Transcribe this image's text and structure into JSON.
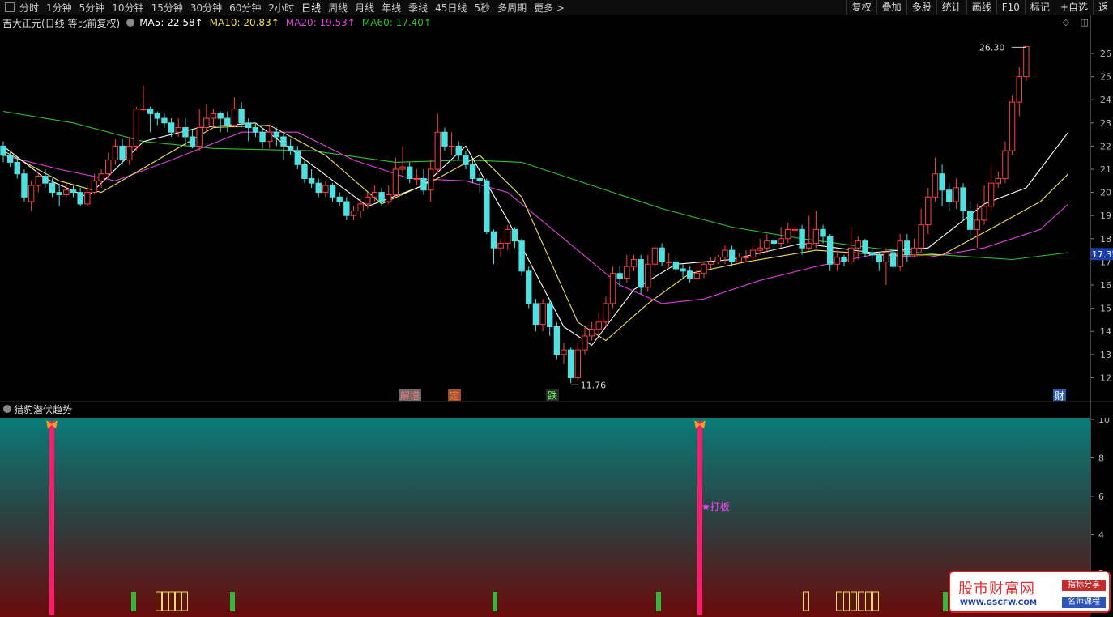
{
  "toolbar": {
    "periods": [
      "分时",
      "1分钟",
      "5分钟",
      "10分钟",
      "15分钟",
      "30分钟",
      "60分钟",
      "2小时",
      "日线",
      "周线",
      "月线",
      "年线",
      "季线",
      "45日线",
      "5秒",
      "多周期",
      "更多 >"
    ],
    "active_period": "日线",
    "right_buttons": [
      "复权",
      "叠加",
      "多股",
      "统计",
      "画线",
      "F10",
      "标记",
      "+自选",
      "返"
    ]
  },
  "info": {
    "stock_title": "吉大正元(日线 等比前复权)",
    "ma5": "MA5: 22.58↑",
    "ma10": "MA10: 20.83↑",
    "ma20": "MA20: 19.53↑",
    "ma60": "MA60: 17.40↑"
  },
  "colors": {
    "ma5": "#ffffff",
    "ma10": "#f0e060",
    "ma20": "#e040e0",
    "ma60": "#30c030",
    "up": "#ff4040",
    "down": "#50e0e0",
    "price_tag_bg": "#1a3eaa"
  },
  "price_labels": {
    "high_marker": "26.30",
    "low_marker": "11.76",
    "current_price_tag": "17.32"
  },
  "y_axis_ticks": [
    "26",
    "25",
    "24",
    "23",
    "22",
    "21",
    "20",
    "19",
    "18",
    "17",
    "16",
    "15",
    "14",
    "13",
    "12"
  ],
  "event_markers": [
    {
      "label": "解增",
      "color": "#ff8080",
      "bg": "#6a6a6a"
    },
    {
      "label": "定",
      "color": "#ff8040",
      "bg": "#a05030"
    },
    {
      "label": "跌",
      "color": "#60ff60",
      "bg": "#2a2a2a"
    },
    {
      "label": "财",
      "color": "#ffffff",
      "bg": "#2a5ab0"
    }
  ],
  "indicator": {
    "title": "猎豹潜伏趋势",
    "signal_label": "★打板",
    "y_ticks": [
      "10",
      "8",
      "6",
      "4",
      "2"
    ]
  },
  "watermark": {
    "name": "股市财富网",
    "url": "WWW.GSCFW.COM",
    "tag1": "指标分享",
    "tag2": "名师课程"
  },
  "chart_data": {
    "type": "candlestick",
    "y_range": [
      11.5,
      26.6
    ],
    "candles": [
      [
        22.0,
        21.6,
        22.2,
        21.3
      ],
      [
        21.6,
        21.3,
        21.8,
        21.1
      ],
      [
        21.3,
        20.8,
        21.5,
        20.6
      ],
      [
        20.8,
        19.8,
        21.0,
        19.6
      ],
      [
        19.6,
        20.3,
        20.5,
        19.2
      ],
      [
        20.3,
        20.7,
        20.9,
        20.0
      ],
      [
        20.7,
        20.4,
        21.0,
        20.2
      ],
      [
        20.4,
        20.0,
        20.6,
        19.8
      ],
      [
        20.0,
        19.9,
        20.3,
        19.4
      ],
      [
        19.9,
        20.1,
        20.4,
        19.8
      ],
      [
        20.1,
        20.0,
        20.3,
        19.8
      ],
      [
        20.0,
        19.5,
        20.2,
        19.4
      ],
      [
        19.5,
        20.0,
        20.3,
        19.4
      ],
      [
        20.0,
        20.5,
        20.8,
        19.9
      ],
      [
        20.5,
        20.8,
        21.0,
        20.2
      ],
      [
        20.8,
        21.4,
        21.7,
        20.6
      ],
      [
        21.4,
        22.0,
        22.3,
        21.2
      ],
      [
        22.0,
        21.4,
        22.3,
        21.2
      ],
      [
        21.4,
        22.0,
        22.4,
        21.2
      ],
      [
        22.0,
        23.6,
        23.7,
        21.8
      ],
      [
        23.6,
        23.6,
        24.6,
        23.5
      ],
      [
        23.6,
        23.4,
        23.7,
        22.6
      ],
      [
        23.4,
        23.2,
        23.5,
        22.9
      ],
      [
        23.2,
        23.0,
        23.4,
        22.8
      ],
      [
        23.0,
        22.6,
        23.2,
        22.4
      ],
      [
        22.6,
        22.8,
        23.2,
        22.4
      ],
      [
        22.8,
        22.4,
        23.2,
        22.0
      ],
      [
        22.4,
        22.0,
        22.7,
        21.9
      ],
      [
        22.0,
        22.8,
        23.6,
        21.8
      ],
      [
        22.8,
        23.2,
        23.8,
        22.6
      ],
      [
        23.2,
        23.4,
        23.6,
        22.8
      ],
      [
        23.4,
        23.2,
        23.5,
        22.6
      ],
      [
        23.2,
        22.9,
        23.5,
        22.6
      ],
      [
        22.9,
        23.6,
        24.1,
        22.8
      ],
      [
        23.6,
        23.0,
        23.9,
        22.8
      ],
      [
        23.0,
        22.8,
        23.2,
        22.2
      ],
      [
        22.8,
        22.6,
        23.0,
        22.4
      ],
      [
        22.6,
        22.2,
        22.8,
        21.9
      ],
      [
        22.2,
        22.6,
        22.9,
        21.9
      ],
      [
        22.6,
        22.4,
        22.8,
        22.0
      ],
      [
        22.4,
        22.0,
        22.6,
        21.4
      ],
      [
        22.0,
        21.8,
        22.3,
        21.6
      ],
      [
        21.8,
        21.2,
        22.0,
        21.0
      ],
      [
        21.2,
        20.6,
        21.4,
        20.4
      ],
      [
        20.6,
        20.4,
        21.0,
        20.2
      ],
      [
        20.4,
        20.0,
        20.6,
        19.8
      ],
      [
        20.0,
        20.3,
        20.5,
        19.8
      ],
      [
        20.3,
        19.8,
        20.4,
        19.6
      ],
      [
        19.8,
        19.6,
        20.0,
        19.4
      ],
      [
        19.6,
        19.0,
        19.8,
        18.8
      ],
      [
        19.0,
        19.2,
        19.4,
        18.8
      ],
      [
        19.2,
        19.5,
        19.7,
        18.9
      ],
      [
        19.5,
        19.8,
        20.0,
        19.3
      ],
      [
        19.8,
        20.0,
        20.3,
        19.6
      ],
      [
        20.0,
        19.6,
        20.2,
        19.4
      ],
      [
        19.6,
        19.9,
        20.3,
        19.5
      ],
      [
        19.9,
        21.0,
        21.5,
        19.8
      ],
      [
        21.0,
        21.1,
        22.0,
        20.8
      ],
      [
        21.1,
        20.6,
        21.3,
        20.4
      ],
      [
        20.6,
        20.6,
        21.0,
        20.3
      ],
      [
        20.6,
        20.1,
        21.0,
        19.9
      ],
      [
        20.1,
        21.0,
        21.4,
        19.6
      ],
      [
        21.0,
        22.6,
        23.4,
        20.8
      ],
      [
        22.6,
        22.0,
        22.8,
        21.8
      ],
      [
        22.0,
        22.0,
        22.6,
        21.6
      ],
      [
        22.0,
        21.6,
        22.2,
        21.4
      ],
      [
        21.6,
        21.2,
        21.8,
        21.0
      ],
      [
        21.2,
        20.6,
        21.4,
        20.4
      ],
      [
        20.6,
        20.5,
        20.8,
        20.0
      ],
      [
        20.5,
        18.3,
        20.6,
        18.2
      ],
      [
        18.3,
        17.6,
        18.4,
        16.9
      ],
      [
        17.6,
        17.8,
        18.0,
        17.2
      ],
      [
        17.8,
        18.4,
        18.6,
        17.5
      ],
      [
        18.4,
        17.9,
        18.5,
        17.6
      ],
      [
        17.9,
        16.6,
        18.0,
        16.4
      ],
      [
        16.6,
        15.2,
        16.8,
        15.0
      ],
      [
        15.2,
        14.3,
        15.4,
        14.0
      ],
      [
        14.3,
        15.2,
        15.4,
        14.0
      ],
      [
        15.2,
        14.2,
        15.3,
        13.8
      ],
      [
        14.2,
        13.0,
        14.4,
        12.8
      ],
      [
        13.0,
        13.2,
        13.5,
        12.6
      ],
      [
        13.2,
        12.0,
        13.3,
        11.76
      ],
      [
        12.0,
        13.2,
        13.5,
        11.9
      ],
      [
        13.2,
        13.8,
        14.2,
        13.0
      ],
      [
        13.8,
        14.1,
        14.4,
        13.6
      ],
      [
        14.1,
        14.4,
        14.8,
        13.9
      ],
      [
        14.4,
        15.2,
        15.5,
        14.2
      ],
      [
        15.2,
        16.5,
        16.8,
        15.0
      ],
      [
        16.5,
        16.3,
        16.8,
        15.9
      ],
      [
        16.3,
        16.8,
        17.3,
        16.1
      ],
      [
        16.8,
        17.1,
        17.3,
        16.6
      ],
      [
        17.1,
        15.9,
        17.3,
        15.6
      ],
      [
        15.9,
        16.9,
        17.3,
        15.7
      ],
      [
        16.9,
        17.6,
        17.7,
        16.7
      ],
      [
        17.6,
        17.0,
        17.8,
        16.8
      ],
      [
        17.0,
        17.0,
        17.4,
        16.7
      ],
      [
        17.0,
        16.7,
        17.2,
        16.5
      ],
      [
        16.7,
        16.6,
        16.9,
        16.3
      ],
      [
        16.6,
        16.3,
        16.8,
        16.1
      ],
      [
        16.3,
        16.5,
        17.0,
        16.2
      ],
      [
        16.5,
        16.9,
        17.0,
        16.3
      ],
      [
        16.9,
        17.0,
        17.2,
        16.7
      ],
      [
        17.0,
        17.2,
        17.3,
        16.9
      ],
      [
        17.2,
        17.5,
        17.7,
        16.9
      ],
      [
        17.5,
        17.0,
        17.7,
        16.8
      ],
      [
        17.0,
        17.2,
        17.4,
        16.9
      ],
      [
        17.2,
        17.2,
        17.5,
        17.0
      ],
      [
        17.2,
        17.5,
        17.8,
        17.0
      ],
      [
        17.5,
        17.6,
        18.0,
        17.3
      ],
      [
        17.6,
        17.9,
        18.2,
        17.4
      ],
      [
        17.9,
        17.8,
        18.1,
        17.5
      ],
      [
        17.8,
        18.0,
        18.5,
        17.6
      ],
      [
        18.0,
        18.4,
        18.7,
        17.8
      ],
      [
        18.4,
        18.4,
        18.6,
        18.0
      ],
      [
        18.4,
        17.6,
        18.6,
        17.3
      ],
      [
        17.6,
        17.8,
        19.0,
        17.5
      ],
      [
        17.8,
        18.4,
        19.2,
        17.6
      ],
      [
        18.4,
        18.1,
        18.6,
        17.8
      ],
      [
        18.1,
        16.9,
        18.2,
        16.6
      ],
      [
        16.9,
        17.2,
        17.5,
        16.6
      ],
      [
        17.2,
        17.0,
        17.3,
        16.8
      ],
      [
        17.0,
        17.6,
        18.5,
        16.9
      ],
      [
        17.6,
        17.9,
        18.1,
        17.1
      ],
      [
        17.9,
        17.4,
        18.0,
        17.2
      ],
      [
        17.4,
        17.3,
        17.6,
        17.0
      ],
      [
        17.3,
        17.0,
        17.4,
        16.6
      ],
      [
        17.0,
        17.4,
        17.6,
        16.0
      ],
      [
        17.4,
        16.8,
        17.6,
        16.6
      ],
      [
        16.8,
        17.9,
        18.2,
        16.6
      ],
      [
        17.9,
        17.3,
        18.2,
        17.0
      ],
      [
        17.3,
        17.6,
        18.0,
        17.2
      ],
      [
        17.6,
        18.6,
        19.3,
        17.4
      ],
      [
        18.6,
        19.8,
        20.2,
        18.2
      ],
      [
        19.8,
        20.8,
        21.5,
        19.6
      ],
      [
        20.8,
        20.1,
        21.2,
        19.4
      ],
      [
        20.1,
        19.6,
        20.4,
        19.2
      ],
      [
        19.6,
        20.2,
        20.6,
        19.3
      ],
      [
        20.2,
        19.2,
        20.4,
        18.8
      ],
      [
        19.2,
        18.4,
        19.6,
        18.0
      ],
      [
        18.4,
        18.8,
        19.5,
        17.6
      ],
      [
        18.8,
        19.4,
        20.3,
        18.6
      ],
      [
        19.4,
        20.4,
        21.2,
        19.2
      ],
      [
        20.4,
        20.6,
        20.9,
        20.2
      ],
      [
        20.6,
        21.8,
        22.2,
        20.4
      ],
      [
        21.8,
        23.9,
        24.2,
        21.6
      ],
      [
        23.9,
        25.0,
        25.4,
        23.3
      ],
      [
        25.0,
        26.3,
        26.3,
        24.8
      ]
    ],
    "ma5": [
      [
        0,
        22.0
      ],
      [
        6,
        20.6
      ],
      [
        12,
        19.8
      ],
      [
        20,
        22.2
      ],
      [
        28,
        22.8
      ],
      [
        36,
        23.0
      ],
      [
        44,
        21.2
      ],
      [
        52,
        19.4
      ],
      [
        60,
        20.3
      ],
      [
        66,
        22.0
      ],
      [
        72,
        18.8
      ],
      [
        80,
        14.2
      ],
      [
        84,
        13.4
      ],
      [
        90,
        15.8
      ],
      [
        96,
        16.9
      ],
      [
        104,
        17.1
      ],
      [
        114,
        17.8
      ],
      [
        124,
        17.4
      ],
      [
        132,
        17.6
      ],
      [
        140,
        19.5
      ],
      [
        146,
        20.2
      ],
      [
        152,
        22.6
      ]
    ],
    "ma10": [
      [
        0,
        21.8
      ],
      [
        8,
        20.5
      ],
      [
        14,
        20.0
      ],
      [
        22,
        21.4
      ],
      [
        30,
        22.8
      ],
      [
        38,
        22.9
      ],
      [
        46,
        21.6
      ],
      [
        54,
        19.5
      ],
      [
        62,
        20.6
      ],
      [
        68,
        21.6
      ],
      [
        74,
        19.8
      ],
      [
        82,
        14.4
      ],
      [
        86,
        13.6
      ],
      [
        92,
        15.2
      ],
      [
        98,
        16.5
      ],
      [
        106,
        17.0
      ],
      [
        116,
        17.5
      ],
      [
        126,
        17.3
      ],
      [
        134,
        17.3
      ],
      [
        142,
        18.6
      ],
      [
        148,
        19.6
      ],
      [
        152,
        20.8
      ]
    ],
    "ma20": [
      [
        0,
        21.6
      ],
      [
        8,
        21.0
      ],
      [
        16,
        20.5
      ],
      [
        24,
        21.4
      ],
      [
        34,
        22.6
      ],
      [
        42,
        22.6
      ],
      [
        50,
        21.4
      ],
      [
        58,
        20.6
      ],
      [
        66,
        20.5
      ],
      [
        72,
        20.0
      ],
      [
        80,
        18.0
      ],
      [
        88,
        16.0
      ],
      [
        94,
        15.2
      ],
      [
        100,
        15.4
      ],
      [
        108,
        16.2
      ],
      [
        116,
        16.8
      ],
      [
        124,
        17.3
      ],
      [
        132,
        17.2
      ],
      [
        140,
        17.6
      ],
      [
        148,
        18.4
      ],
      [
        152,
        19.5
      ]
    ],
    "ma60": [
      [
        0,
        23.5
      ],
      [
        10,
        23.0
      ],
      [
        20,
        22.2
      ],
      [
        30,
        21.9
      ],
      [
        44,
        21.8
      ],
      [
        56,
        21.3
      ],
      [
        66,
        21.4
      ],
      [
        74,
        21.3
      ],
      [
        84,
        20.3
      ],
      [
        94,
        19.3
      ],
      [
        104,
        18.5
      ],
      [
        114,
        18.0
      ],
      [
        124,
        17.6
      ],
      [
        134,
        17.3
      ],
      [
        144,
        17.1
      ],
      [
        152,
        17.4
      ]
    ],
    "indicator_bars": {
      "pink_signals": [
        6,
        86
      ],
      "green_bars": [
        16,
        28,
        61,
        81,
        116
      ],
      "yellow_outline_bars": [
        19,
        20,
        21,
        22,
        99,
        103,
        104,
        105,
        106,
        107,
        108
      ]
    }
  }
}
